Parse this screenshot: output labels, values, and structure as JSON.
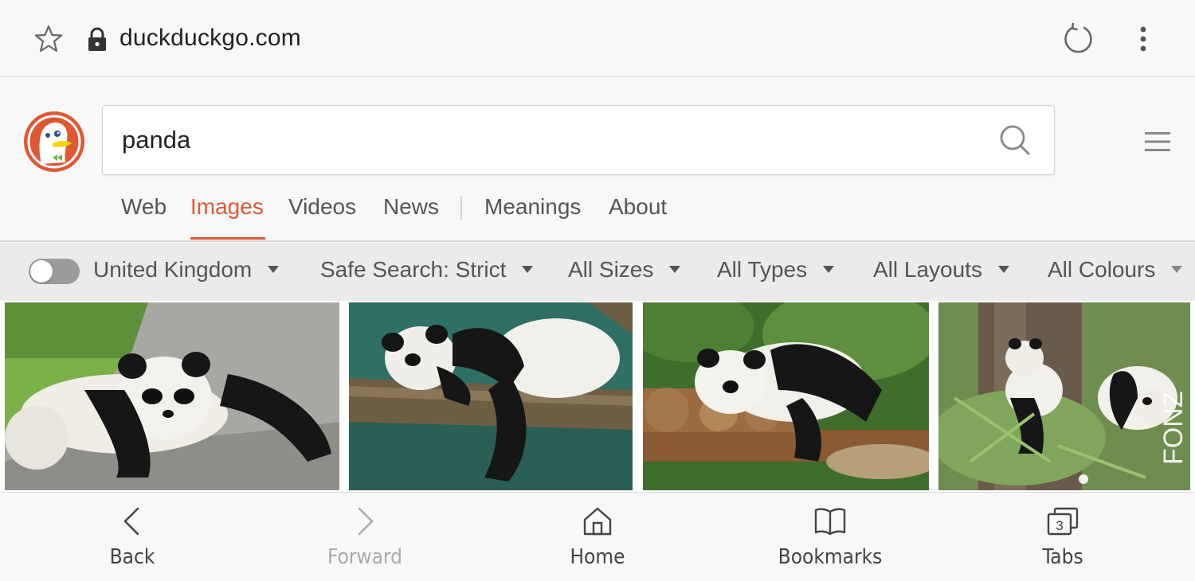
{
  "address_bar": {
    "url": "duckduckgo.com",
    "star_icon": "star-outline-icon",
    "lock_icon": "lock-icon",
    "reload_icon": "reload-icon",
    "menu_icon": "vertical-dots-icon"
  },
  "header": {
    "logo": "duckduckgo-logo",
    "search": {
      "value": "panda",
      "icon": "search-icon"
    },
    "menu_icon": "hamburger-icon"
  },
  "tabs": [
    {
      "label": "Web",
      "active": false
    },
    {
      "label": "Images",
      "active": true
    },
    {
      "label": "Videos",
      "active": false
    },
    {
      "label": "News",
      "active": false
    },
    {
      "label": "Meanings",
      "active": false
    },
    {
      "label": "About",
      "active": false
    }
  ],
  "filters": {
    "region_toggle_on": false,
    "items": [
      {
        "label": "United Kingdom"
      },
      {
        "label": "Safe Search: Strict"
      },
      {
        "label": "All Sizes"
      },
      {
        "label": "All Types"
      },
      {
        "label": "All Layouts"
      },
      {
        "label": "All Colours"
      }
    ]
  },
  "images": [
    {
      "alt": "panda-on-rock-photo"
    },
    {
      "alt": "panda-on-branch-photo"
    },
    {
      "alt": "panda-on-logs-photo"
    },
    {
      "alt": "pandas-bamboo-photo",
      "overlay_text": "FONZ"
    }
  ],
  "bottom_nav": [
    {
      "label": "Back",
      "icon": "chevron-left-icon",
      "enabled": true
    },
    {
      "label": "Forward",
      "icon": "chevron-right-icon",
      "enabled": false
    },
    {
      "label": "Home",
      "icon": "home-icon",
      "enabled": true
    },
    {
      "label": "Bookmarks",
      "icon": "book-icon",
      "enabled": true
    },
    {
      "label": "Tabs",
      "icon": "tabs-icon",
      "enabled": true,
      "count": "3"
    }
  ],
  "colors": {
    "accent": "#de5833",
    "text": "#555555",
    "background": "#f8f8f8",
    "filter_bar": "#ebebeb"
  }
}
